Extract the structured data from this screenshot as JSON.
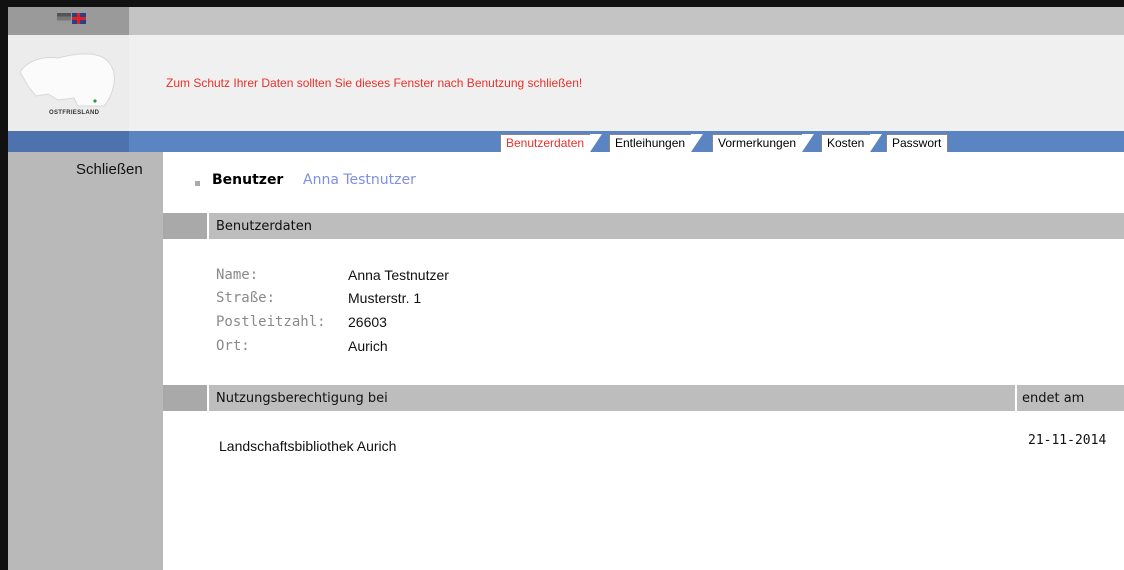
{
  "header": {
    "logo_text": "OSTFRIESLAND",
    "warning": "Zum Schutz Ihrer Daten sollten Sie dieses Fenster nach Benutzung schließen!"
  },
  "tabs": [
    {
      "label": "Benutzerdaten",
      "active": true
    },
    {
      "label": "Entleihungen",
      "active": false
    },
    {
      "label": "Vormerkungen",
      "active": false
    },
    {
      "label": "Kosten",
      "active": false
    },
    {
      "label": "Passwort",
      "active": false
    }
  ],
  "sidebar": {
    "close_label": "Schließen"
  },
  "user": {
    "label": "Benutzer",
    "name": "Anna Testnutzer"
  },
  "userdata": {
    "section_title": "Benutzerdaten",
    "fields": [
      {
        "label": "Name:",
        "value": "Anna Testnutzer"
      },
      {
        "label": "Straße:",
        "value": "Musterstr. 1"
      },
      {
        "label": "Postleitzahl:",
        "value": "26603"
      },
      {
        "label": "Ort:",
        "value": "Aurich"
      }
    ]
  },
  "permissions": {
    "col_library": "Nutzungsberechtigung bei",
    "col_ends": "endet am",
    "rows": [
      {
        "library": "Landschaftsbibliothek Aurich",
        "ends": "21-11-2014"
      }
    ]
  },
  "colors": {
    "accent_blue": "#5b84c2",
    "warning_red": "#e8312a",
    "user_name": "#7f8fe0",
    "sidebar_gray": "#b9b9b9"
  }
}
